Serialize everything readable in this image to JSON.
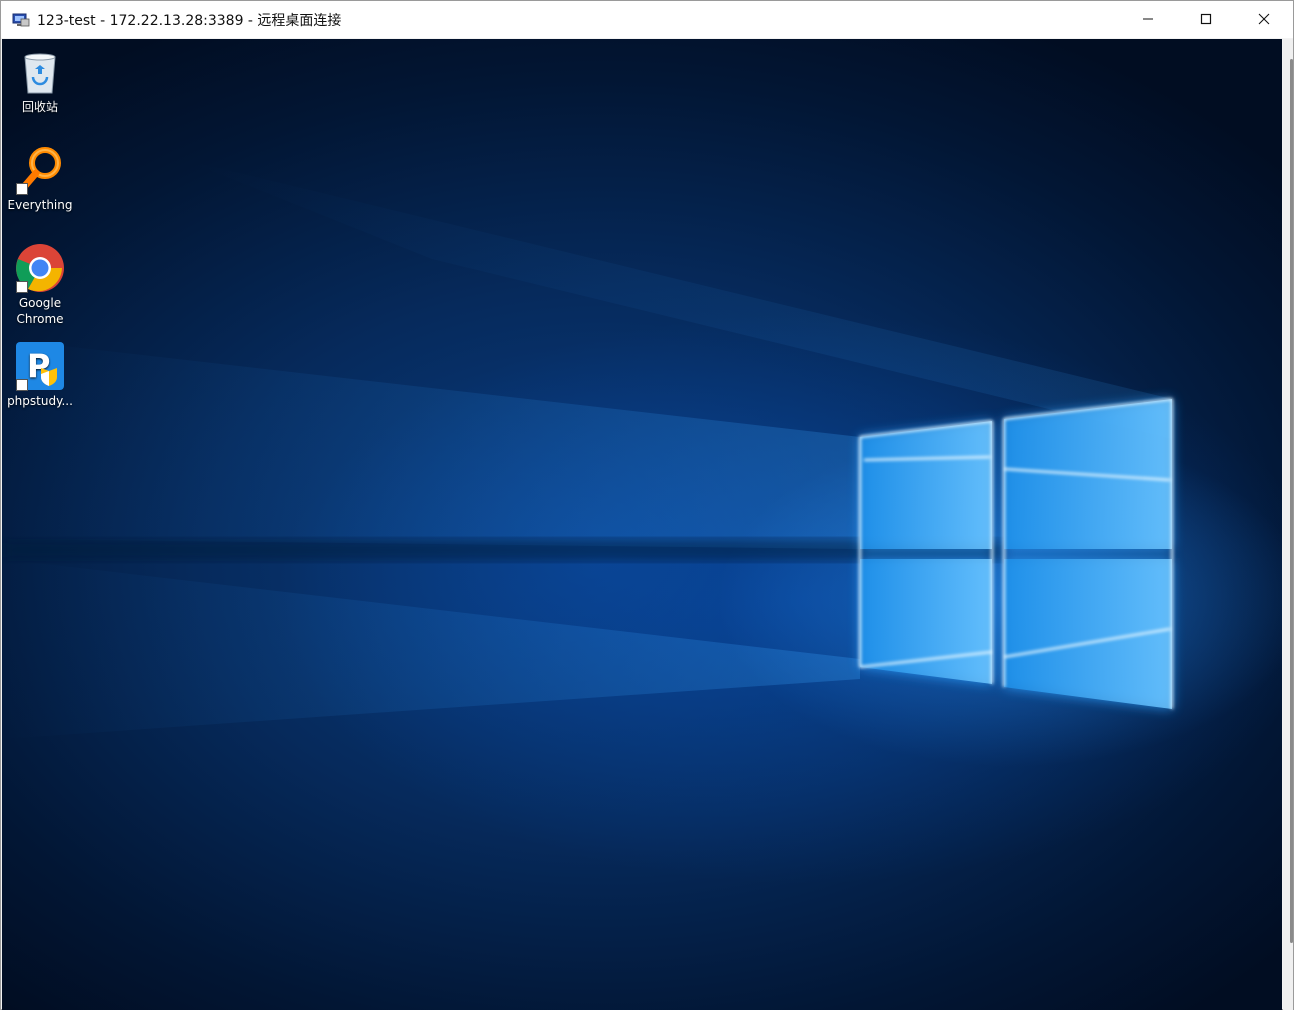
{
  "window": {
    "title": "123-test - 172.22.13.28:3389 - 远程桌面连接",
    "minimize_icon": "minimize-icon",
    "maximize_icon": "maximize-icon",
    "close_icon": "close-icon"
  },
  "desktop": {
    "icons": [
      {
        "label": "回收站",
        "icon": "recycle-bin-icon"
      },
      {
        "label": "Everything",
        "icon": "everything-search-icon"
      },
      {
        "label": "Google Chrome",
        "icon": "chrome-icon"
      },
      {
        "label": "phpstudy...",
        "icon": "phpstudy-icon"
      }
    ],
    "wallpaper": "windows-10-hero-wallpaper"
  },
  "colors": {
    "titlebar": "#ffffff",
    "wallpaper_dark": "#021634",
    "wallpaper_glow": "#2a9bff"
  }
}
